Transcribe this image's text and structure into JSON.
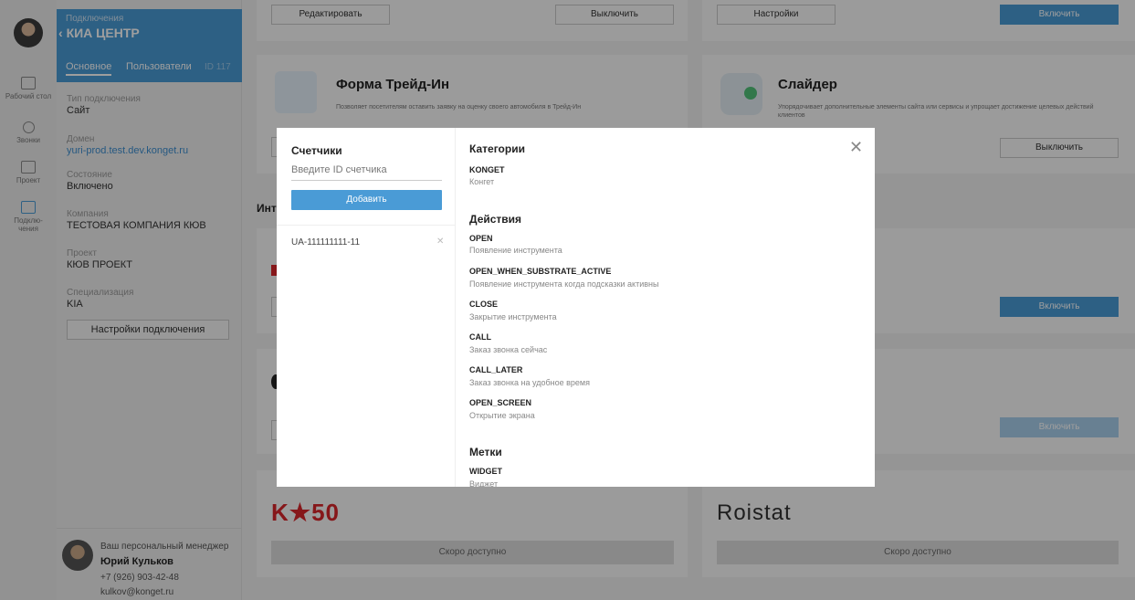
{
  "sidebar_rail": {
    "items": [
      {
        "label": "Рабочий стол",
        "icon": "desktop-icon"
      },
      {
        "label": "Звонки",
        "icon": "headset-icon"
      },
      {
        "label": "Проект",
        "icon": "folder-icon"
      },
      {
        "label": "Подклю-чения",
        "icon": "antenna-icon"
      }
    ]
  },
  "panel": {
    "breadcrumb": "Подключения",
    "back_icon": "chevron-left-icon",
    "title": "КИА ЦЕНТР",
    "tabs": [
      "Основное",
      "Пользователи"
    ],
    "id_label": "ID 117",
    "fields": [
      {
        "label": "Тип подключения",
        "value": "Сайт"
      },
      {
        "label": "Домен",
        "value": "yuri-prod.test.dev.konget.ru"
      },
      {
        "label": "Состояние",
        "value": "Включено"
      },
      {
        "label": "Компания",
        "value": "ТЕСТОВАЯ КОМПАНИЯ КЮВ"
      },
      {
        "label": "Проект",
        "value": "КЮВ ПРОЕКТ"
      },
      {
        "label": "Специализация",
        "value": "KIA"
      }
    ],
    "settings_button": "Настройки подключения",
    "manager": {
      "title": "Ваш персональный менеджер",
      "name": "Юрий Кульков",
      "phone": "+7 (926) 903-42-48",
      "email": "kulkov@konget.ru"
    }
  },
  "main": {
    "top_buttons": [
      "Редактировать",
      "Выключить",
      "Настройки",
      "Включить"
    ],
    "cards": [
      {
        "title": "Форма Трейд-Ин",
        "desc": "Позволяет посетителям оставить заявку на оценку своего автомобиля в Трейд-Ин"
      },
      {
        "title": "Слайдер",
        "desc": "Упорядочивает дополнительные элементы сайта или сервисы и упрощает достижение целевых действий клиентов",
        "button": "Выключить"
      }
    ],
    "section_partial": "Инт",
    "right_buttons": [
      "Включить",
      "Включить"
    ],
    "bottom_logos": [
      "K★50",
      "Roistat"
    ],
    "coming_soon": [
      "Скоро доступно",
      "Скоро доступно"
    ]
  },
  "modal": {
    "left_title": "Счетчики",
    "input_placeholder": "Введите ID счетчика",
    "add_button": "Добавить",
    "counters": [
      {
        "id": "UA-111111111-11",
        "remove_icon": "remove-icon"
      }
    ],
    "close_icon": "close-icon",
    "categories_title": "Категории",
    "categories": [
      {
        "code": "KONGET",
        "desc": "Конгет"
      }
    ],
    "actions_title": "Действия",
    "actions": [
      {
        "code": "OPEN",
        "desc": "Появление инструмента"
      },
      {
        "code": "OPEN_WHEN_SUBSTRATE_ACTIVE",
        "desc": "Появление инструмента когда подсказки активны"
      },
      {
        "code": "CLOSE",
        "desc": "Закрытие инструмента"
      },
      {
        "code": "CALL",
        "desc": "Заказ звонка сейчас"
      },
      {
        "code": "CALL_LATER",
        "desc": "Заказ звонка на удобное время"
      },
      {
        "code": "OPEN_SCREEN",
        "desc": "Открытие экрана"
      }
    ],
    "labels_title": "Метки",
    "labels": [
      {
        "code": "WIDGET",
        "desc": "Виджет"
      }
    ]
  },
  "colors": {
    "accent": "#4a9bd6",
    "logo_red": "#d9262b"
  }
}
